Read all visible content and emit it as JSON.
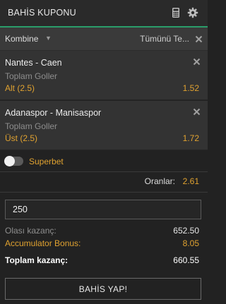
{
  "header": {
    "title": "BAHİS KUPONU",
    "icons": [
      "calculator-icon",
      "gear-icon"
    ]
  },
  "toolbar": {
    "bet_type": "Kombine",
    "clear_all": "Tümünü Te..."
  },
  "bets": [
    {
      "match": "Nantes - Caen",
      "market": "Toplam Goller",
      "selection": "Alt (2.5)",
      "odds": "1.52"
    },
    {
      "match": "Adanaspor - Manisaspor",
      "market": "Toplam Goller",
      "selection": "Üst (2.5)",
      "odds": "1.72"
    }
  ],
  "superbet": {
    "label": "Superbet",
    "enabled": false
  },
  "odds_summary": {
    "label": "Oranlar:",
    "value": "2.61"
  },
  "stake": {
    "value": "250"
  },
  "summary": {
    "potential_label": "Olası kazanç:",
    "potential_value": "652.50",
    "bonus_label": "Accumulator Bonus:",
    "bonus_value": "8.05",
    "total_label": "Toplam kazanç:",
    "total_value": "660.55"
  },
  "place_bet_label": "BAHİS YAP!",
  "colors": {
    "accent_orange": "#e0a230",
    "header_underline": "#2a9d6a",
    "background": "#222222"
  }
}
